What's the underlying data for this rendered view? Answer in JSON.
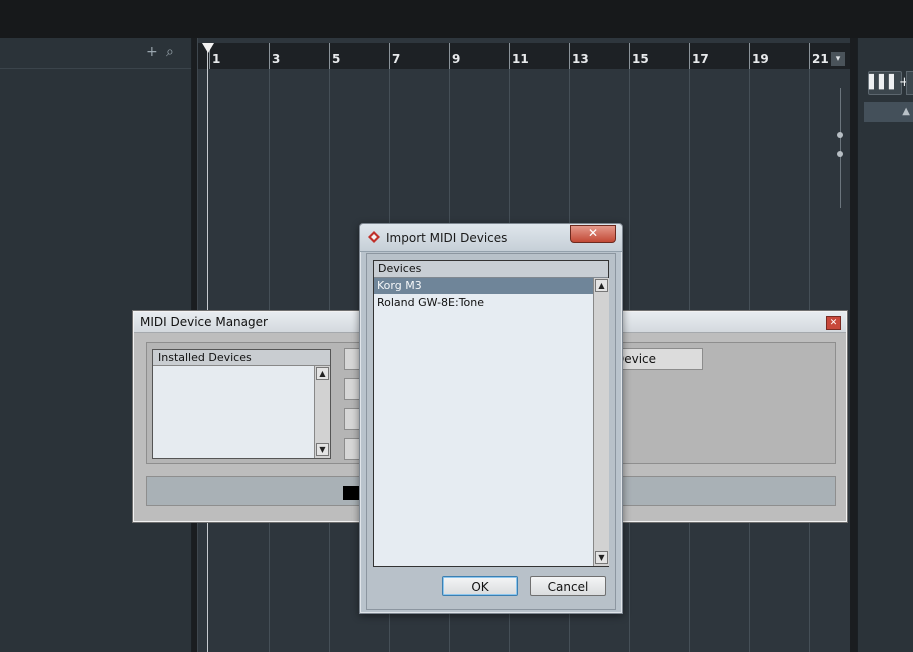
{
  "left_panel": {
    "add_icon": "+",
    "search_icon": "⌕"
  },
  "ruler": {
    "bars": [
      "1",
      "3",
      "5",
      "7",
      "9",
      "11",
      "13",
      "15",
      "17",
      "19",
      "21"
    ],
    "menu_icon": "▾"
  },
  "right_panel": {
    "keyboard_button": "▌▌▌+",
    "up_arrow": "▲"
  },
  "midi_device_manager": {
    "title": "MIDI Device Manager",
    "close_icon": "✕",
    "installed_devices_header": "Installed Devices",
    "device_button_partial": "Device",
    "scroll_up": "▲",
    "scroll_down": "▼"
  },
  "import_dialog": {
    "title": "Import MIDI Devices",
    "close_icon": "✕",
    "list_header": "Devices",
    "devices": [
      "Korg M3",
      "Roland GW-8E:Tone"
    ],
    "selected_index": 0,
    "ok_label": "OK",
    "cancel_label": "Cancel",
    "scroll_up": "▲",
    "scroll_down": "▼"
  }
}
